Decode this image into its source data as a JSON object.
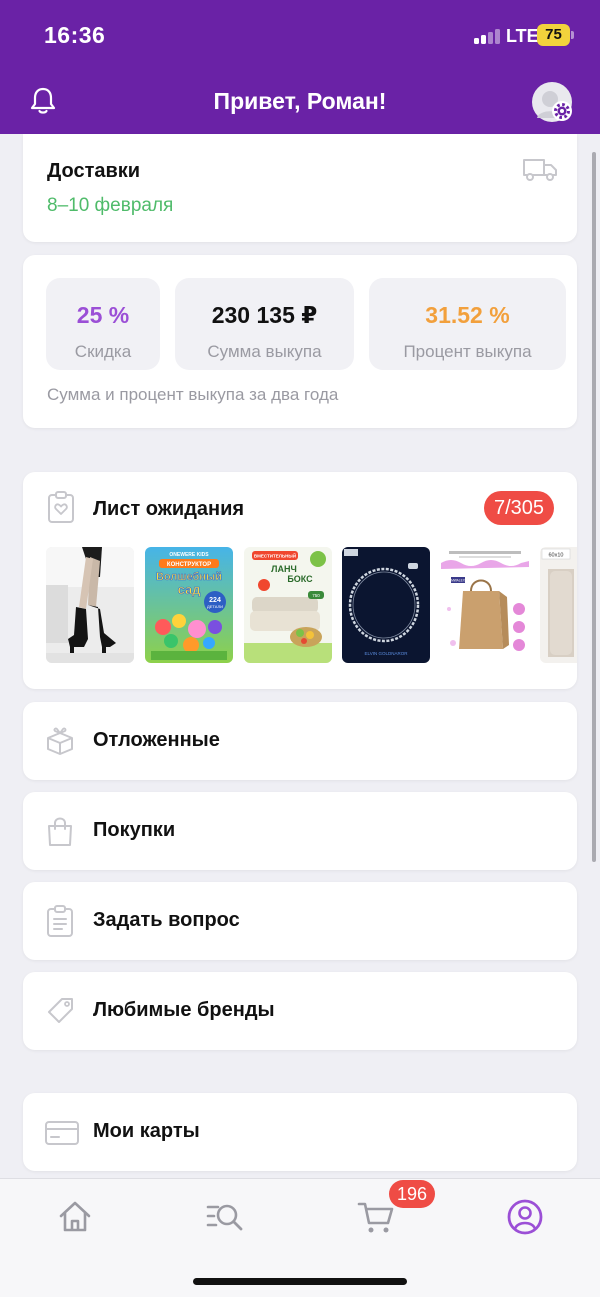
{
  "status_bar": {
    "time": "16:36",
    "network": "LTE",
    "battery": "75"
  },
  "header": {
    "greeting": "Привет, Роман!"
  },
  "deliveries": {
    "title": "Доставки",
    "date": "8–10 февраля"
  },
  "stats": {
    "items": [
      {
        "value": "25 %",
        "label": "Скидка",
        "color": "#9b4fd6"
      },
      {
        "value": "230 135 ₽",
        "label": "Сумма выкупа",
        "color": "#111111"
      },
      {
        "value": "31.52 %",
        "label": "Процент выкупа",
        "color": "#f2a03c"
      }
    ],
    "note": "Сумма и процент выкупа за два года"
  },
  "waitlist": {
    "title": "Лист ожидания",
    "badge": "7/305",
    "thumb_texts": {
      "kit_brand": "ONEWERE KIDS",
      "kit_tag": "КОНСТРУКТОР",
      "kit_title_1": "Волшебный",
      "kit_title_2": "сад",
      "kit_count_1": "224",
      "kit_count_2": "ДЕТАЛИ",
      "lunch_tag": "ВМЕСТИТЕЛЬНЫЙ",
      "lunch_title_1": "ЛАНЧ",
      "lunch_title_2": "БОКС",
      "lunch_volume": "750",
      "chain_brand": "ELVIN GOLDNAROR",
      "bag_brand": "MWALEX",
      "rug_size": "60x10"
    }
  },
  "menu": [
    {
      "label": "Отложенные",
      "icon": "gift-box-icon"
    },
    {
      "label": "Покупки",
      "icon": "shopping-bag-icon"
    },
    {
      "label": "Задать вопрос",
      "icon": "clipboard-icon"
    },
    {
      "label": "Любимые бренды",
      "icon": "tag-icon"
    },
    {
      "label": "Мои карты",
      "icon": "credit-card-icon"
    }
  ],
  "tabbar": {
    "cart_count": "196",
    "active_color": "#9b4fd6",
    "inactive_color": "#9a9aa2"
  },
  "colors": {
    "brand": "#6a22a6",
    "green": "#4fbb6a",
    "badge": "#ef4c45"
  }
}
